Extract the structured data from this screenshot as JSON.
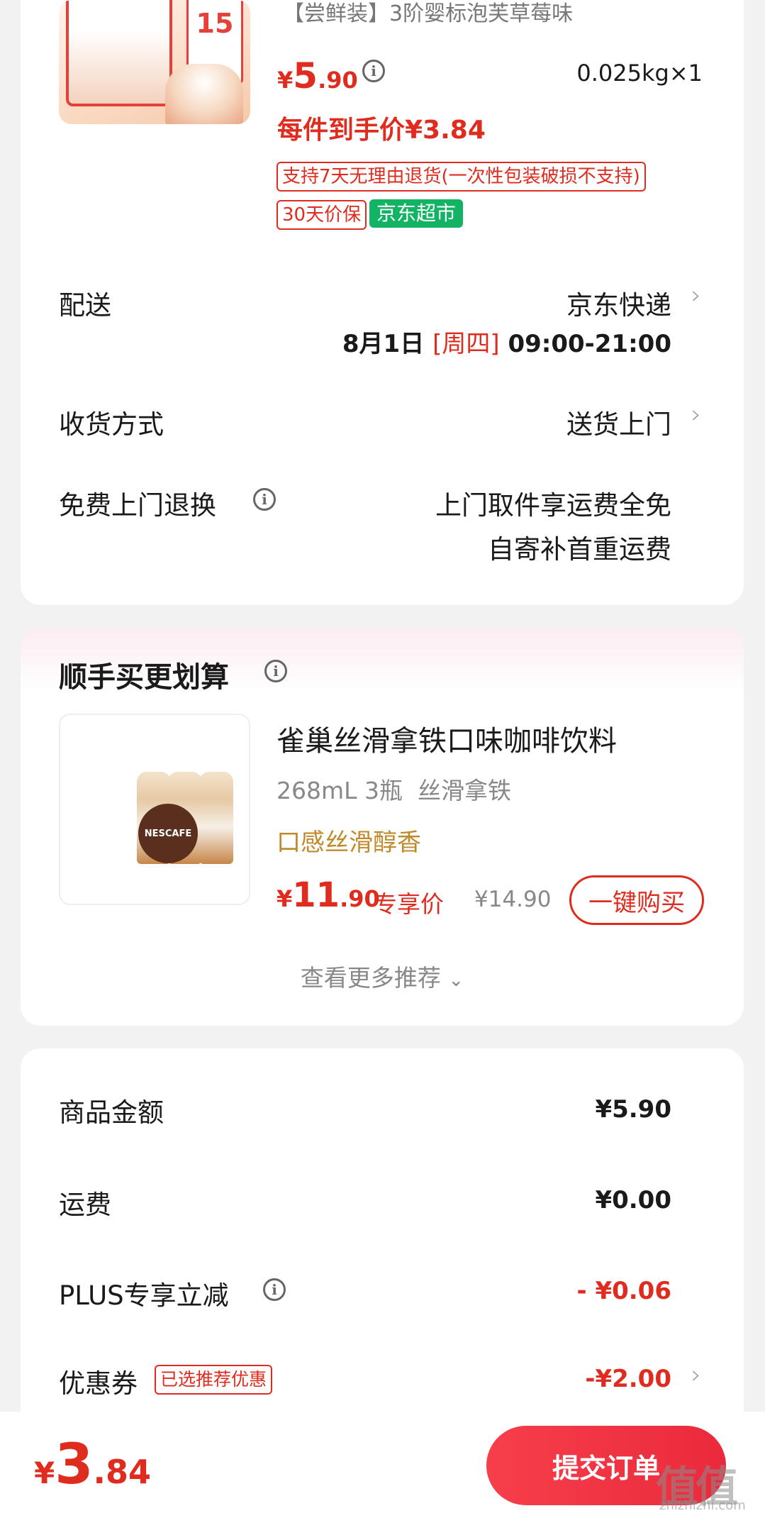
{
  "product": {
    "title": "【尝鲜装】3阶婴标泡芙草莓味",
    "price_symbol": "¥",
    "price_int": "5",
    "price_dec": ".90",
    "quantity": "0.025kg×1",
    "final_price": "每件到手价¥3.84",
    "image_coupon_text": "15",
    "tag_return": "支持7天无理由退货(一次性包装破损不支持)",
    "tag_price_protect": "30天价保",
    "tag_store": "京东超市",
    "store_color": "#12b363"
  },
  "delivery": {
    "label": "配送",
    "method": "京东快递",
    "date": "8月1日",
    "weekday": "[周四]",
    "time": "09:00-21:00"
  },
  "receive": {
    "label": "收货方式",
    "value": "送货上门"
  },
  "free_return": {
    "label": "免费上门退换",
    "line1": "上门取件享运费全免",
    "line2": "自寄补首重运费"
  },
  "recommend": {
    "section_title": "顺手买更划算",
    "item_title": "雀巢丝滑拿铁口味咖啡饮料",
    "spec": "268mL 3瓶  丝滑拿铁",
    "slogan": "口感丝滑醇香",
    "price_symbol": "¥",
    "price_int": "11",
    "price_dec": ".90",
    "price_label": "专享价",
    "original_price": "¥14.90",
    "buy_button": "一键购买",
    "more_link": "查看更多推荐",
    "image_brand": "NESCAFE"
  },
  "summary": {
    "goods_label": "商品金额",
    "goods_value": "¥5.90",
    "shipping_label": "运费",
    "shipping_value": "¥0.00",
    "plus_label": "PLUS专享立减",
    "plus_value": "- ¥0.06",
    "coupon_label": "优惠券",
    "coupon_tag": "已选推荐优惠",
    "coupon_value": "-¥2.00"
  },
  "footer": {
    "total_symbol": "¥",
    "total_int": "3",
    "total_dec": ".84",
    "submit_button": "提交订单",
    "watermark": "值值值",
    "watermark_site": "zhizhizhi.com"
  },
  "colors": {
    "accent_red": "#e02c1f",
    "slogan_gold": "#c08a2b",
    "page_bg": "#f2f2f2"
  }
}
